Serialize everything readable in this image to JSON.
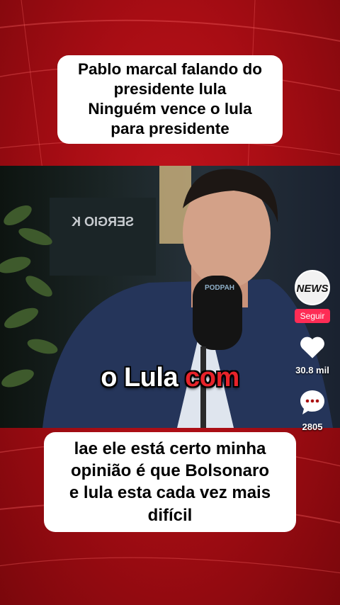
{
  "top_caption": {
    "lines": [
      "Pablo marcal  falando do",
      "presidente lula",
      "Ninguém vence o lula",
      "para presidente"
    ]
  },
  "video": {
    "background_sign": "SERGIO K",
    "mic_brand": "PODPAH",
    "subtitle_plain": "o Lula",
    "subtitle_highlight": "com"
  },
  "side_rail": {
    "avatar_text": "NEWS",
    "follow_label": "Seguir",
    "likes_count": "30.8 mil",
    "comments_count": "2805"
  },
  "bottom_caption": {
    "lines": [
      "lae ele está certo minha",
      "opinião é que Bolsonaro",
      "e lula esta cada vez mais",
      "difícil"
    ]
  },
  "colors": {
    "background": "#b0101a",
    "follow_button": "#fe2c55",
    "highlight": "#e8232a"
  }
}
